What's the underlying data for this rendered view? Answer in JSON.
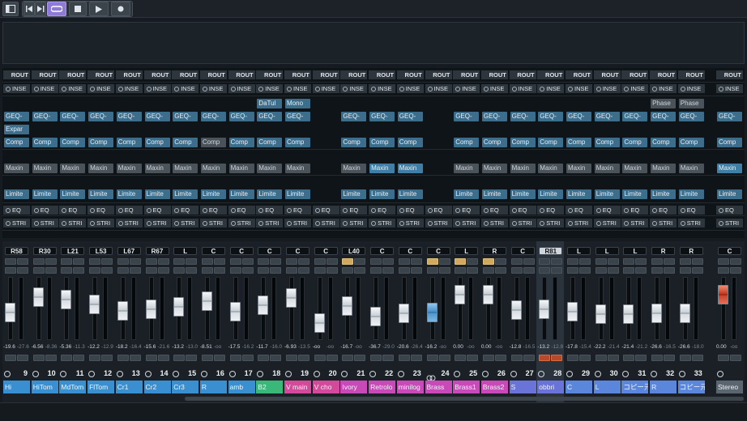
{
  "toolbar": {
    "buttons": [
      {
        "name": "window-layout-button",
        "icon": "layout-icon"
      },
      {
        "name": "go-to-start-button",
        "icon": "skip-back-icon"
      },
      {
        "name": "go-to-end-button",
        "icon": "skip-forward-icon"
      },
      {
        "name": "cycle-button",
        "icon": "cycle-icon",
        "active": true
      },
      {
        "name": "stop-button",
        "icon": "stop-icon"
      },
      {
        "name": "play-button",
        "icon": "play-icon"
      },
      {
        "name": "record-button",
        "icon": "record-icon"
      }
    ],
    "accent": "#8e7bd8"
  },
  "rack_labels": {
    "routing": "ROUT",
    "inserts": "INSE",
    "eq": "EQ",
    "strip": "STRI"
  },
  "channels": [
    {
      "pan": "R58",
      "vol": "-19.6",
      "peak": "-27.6",
      "num": "9",
      "name": "Hi",
      "color": "#3a8fd0",
      "fader": 0.42,
      "plugins": [
        "",
        "",
        "GEQ-",
        "Expar",
        "Comp",
        "Maxin",
        "Limite"
      ],
      "pstyle": [
        "",
        "",
        "b",
        "b",
        "b",
        "g",
        "b"
      ]
    },
    {
      "pan": "R30",
      "vol": "-6.56",
      "peak": "-8.36",
      "num": "10",
      "name": "HiTom",
      "color": "#3a8fd0",
      "fader": 0.78,
      "plugins": [
        "",
        "",
        "GEQ-",
        "",
        "Comp",
        "Maxin",
        "Limite"
      ],
      "pstyle": [
        "",
        "",
        "b",
        "",
        "b",
        "g",
        "b"
      ]
    },
    {
      "pan": "L21",
      "vol": "-5.36",
      "peak": "-11.3",
      "num": "11",
      "name": "MdTom",
      "color": "#3a8fd0",
      "fader": 0.72,
      "plugins": [
        "",
        "",
        "GEQ-",
        "",
        "Comp",
        "Maxin",
        "Limite"
      ],
      "pstyle": [
        "",
        "",
        "b",
        "",
        "b",
        "g",
        "b"
      ]
    },
    {
      "pan": "L53",
      "vol": "-12.2",
      "peak": "-12.9",
      "num": "12",
      "name": "FlTom",
      "color": "#3a8fd0",
      "fader": 0.62,
      "plugins": [
        "",
        "",
        "GEQ-",
        "",
        "Comp",
        "Maxin",
        "Limite"
      ],
      "pstyle": [
        "",
        "",
        "b",
        "",
        "b",
        "g",
        "b"
      ]
    },
    {
      "pan": "L67",
      "vol": "-18.2",
      "peak": "-16.4",
      "num": "13",
      "name": "Cr1",
      "color": "#3a8fd0",
      "fader": 0.46,
      "plugins": [
        "",
        "",
        "GEQ-",
        "",
        "Comp",
        "Maxin",
        "Limite"
      ],
      "pstyle": [
        "",
        "",
        "b",
        "",
        "b",
        "g",
        "b"
      ]
    },
    {
      "pan": "R67",
      "vol": "-15.6",
      "peak": "-21.6",
      "num": "14",
      "name": "Cr2",
      "color": "#3a8fd0",
      "fader": 0.5,
      "plugins": [
        "",
        "",
        "GEQ-",
        "",
        "Comp",
        "Maxin",
        "Limite"
      ],
      "pstyle": [
        "",
        "",
        "b",
        "",
        "b",
        "g",
        "b"
      ]
    },
    {
      "pan": "L",
      "vol": "-13.2",
      "peak": "-13.0",
      "num": "15",
      "name": "Cr3",
      "color": "#3a8fd0",
      "fader": 0.55,
      "plugins": [
        "",
        "",
        "GEQ-",
        "",
        "Comp",
        "Maxin",
        "Limite"
      ],
      "pstyle": [
        "",
        "",
        "b",
        "",
        "b",
        "g",
        "b"
      ]
    },
    {
      "pan": "C",
      "vol": "-8.51",
      "peak": "-oo",
      "num": "16",
      "name": "R",
      "color": "#3a8fd0",
      "fader": 0.68,
      "plugins": [
        "",
        "",
        "GEQ-",
        "",
        "Comp",
        "Maxin",
        "Limite"
      ],
      "pstyle": [
        "",
        "",
        "b",
        "",
        "g",
        "g",
        "b"
      ]
    },
    {
      "pan": "C",
      "vol": "-17.5",
      "peak": "-16.2",
      "num": "17",
      "name": "amb",
      "color": "#3a8fd0",
      "fader": 0.45,
      "plugins": [
        "",
        "",
        "GEQ-",
        "",
        "Comp",
        "Maxin",
        "Limite"
      ],
      "pstyle": [
        "",
        "",
        "b",
        "",
        "b",
        "g",
        "b"
      ]
    },
    {
      "pan": "C",
      "vol": "-11.7",
      "peak": "-16.0",
      "num": "18",
      "name": "B2",
      "color": "#3ab87a",
      "fader": 0.6,
      "plugins": [
        "",
        "DaTul",
        "GEQ-",
        "",
        "Comp",
        "Maxin",
        "Limite"
      ],
      "pstyle": [
        "",
        "b",
        "b",
        "",
        "b",
        "g",
        "b"
      ]
    },
    {
      "pan": "C",
      "vol": "-6.93",
      "peak": "-13.5",
      "num": "19",
      "name": "V main",
      "color": "#d44a9a",
      "fader": 0.76,
      "plugins": [
        "",
        "Mono",
        "GEQ-",
        "",
        "Comp",
        "Maxin",
        "Limite"
      ],
      "pstyle": [
        "",
        "b",
        "b",
        "",
        "b",
        "g",
        "b"
      ]
    },
    {
      "pan": "C",
      "vol": "-oo",
      "peak": "-oo",
      "num": "20",
      "name": "V cho",
      "color": "#d44a9a",
      "fader": 0.18,
      "plugins": [
        "",
        "",
        "",
        "",
        "",
        "",
        ""
      ],
      "pstyle": [
        "",
        "",
        "",
        "",
        "",
        "",
        ""
      ]
    },
    {
      "pan": "L40",
      "vol": "-16.7",
      "peak": "-oo",
      "num": "21",
      "name": "Ivory",
      "color": "#c84ab8",
      "fader": 0.58,
      "gold": true,
      "plugins": [
        "",
        "",
        "GEQ-",
        "",
        "Comp",
        "Maxin",
        "Limite"
      ],
      "pstyle": [
        "",
        "",
        "b",
        "",
        "b",
        "g",
        "b"
      ]
    },
    {
      "pan": "C",
      "vol": "-36.7",
      "peak": "-29.0",
      "num": "22",
      "name": "Retrolo",
      "color": "#c84ab8",
      "fader": 0.34,
      "plugins": [
        "",
        "",
        "GEQ-",
        "",
        "Comp",
        "Maxin",
        "Limite"
      ],
      "pstyle": [
        "",
        "",
        "b",
        "",
        "b",
        "bb",
        "b"
      ]
    },
    {
      "pan": "C",
      "vol": "-20.6",
      "peak": "-26.4",
      "num": "23",
      "name": "minilog",
      "color": "#c84ab8",
      "fader": 0.4,
      "plugins": [
        "",
        "",
        "GEQ-",
        "",
        "Comp",
        "Maxin",
        "Limite"
      ],
      "pstyle": [
        "",
        "",
        "b",
        "",
        "b",
        "bb",
        "b"
      ]
    },
    {
      "pan": "C",
      "vol": "-16.2",
      "peak": "-oo",
      "num": "24",
      "name": "Brass",
      "color": "#c84ab8",
      "fader": 0.42,
      "blue": true,
      "gold": true,
      "link": true,
      "plugins": [
        "",
        "",
        "",
        "",
        "",
        "",
        ""
      ],
      "pstyle": [
        "",
        "",
        "",
        "",
        "",
        "",
        ""
      ]
    },
    {
      "pan": "L",
      "vol": "0.00",
      "peak": "-oo",
      "num": "25",
      "name": "Brass1",
      "color": "#c84ab8",
      "fader": 0.84,
      "gold": true,
      "plugins": [
        "",
        "",
        "GEQ-",
        "",
        "Comp",
        "Maxin",
        "Limite"
      ],
      "pstyle": [
        "",
        "",
        "b",
        "",
        "b",
        "g",
        "b"
      ]
    },
    {
      "pan": "R",
      "vol": "0.00",
      "peak": "-oo",
      "num": "26",
      "name": "Brass2",
      "color": "#c84ab8",
      "fader": 0.84,
      "gold": true,
      "plugins": [
        "",
        "",
        "GEQ-",
        "",
        "Comp",
        "Maxin",
        "Limite"
      ],
      "pstyle": [
        "",
        "",
        "b",
        "",
        "b",
        "g",
        "b"
      ]
    },
    {
      "pan": "C",
      "vol": "-12.8",
      "peak": "-16.5",
      "num": "27",
      "name": "S",
      "color": "#6a74d8",
      "fader": 0.48,
      "plugins": [
        "",
        "",
        "GEQ-",
        "",
        "Comp",
        "Maxin",
        "Limite"
      ],
      "pstyle": [
        "",
        "",
        "b",
        "",
        "b",
        "g",
        "b"
      ]
    },
    {
      "pan": "R81",
      "vol": "-13.2",
      "peak": "-12.8",
      "num": "28",
      "name": "obbri",
      "color": "#6a74d8",
      "fader": 0.5,
      "selected": true,
      "red": true,
      "plugins": [
        "",
        "",
        "GEQ-",
        "",
        "Comp",
        "Maxin",
        "Limite"
      ],
      "pstyle": [
        "",
        "",
        "b",
        "",
        "b",
        "g",
        "b"
      ]
    },
    {
      "pan": "L",
      "vol": "-17.8",
      "peak": "-15.4",
      "num": "29",
      "name": "C",
      "color": "#5a86dc",
      "fader": 0.45,
      "plugins": [
        "",
        "",
        "GEQ-",
        "",
        "Comp",
        "Maxin",
        "Limite"
      ],
      "pstyle": [
        "",
        "",
        "b",
        "",
        "b",
        "g",
        "b"
      ]
    },
    {
      "pan": "L",
      "vol": "-22.2",
      "peak": "-21.4",
      "num": "30",
      "name": "L",
      "color": "#5a86dc",
      "fader": 0.38,
      "plugins": [
        "",
        "",
        "GEQ-",
        "",
        "Comp",
        "Maxin",
        "Limite"
      ],
      "pstyle": [
        "",
        "",
        "b",
        "",
        "b",
        "g",
        "b"
      ]
    },
    {
      "pan": "L",
      "vol": "-21.4",
      "peak": "-21.2",
      "num": "31",
      "name": "コピー元",
      "color": "#5a86dc",
      "fader": 0.38,
      "plugins": [
        "",
        "",
        "GEQ-",
        "",
        "Comp",
        "Maxin",
        "Limite"
      ],
      "pstyle": [
        "",
        "",
        "b",
        "",
        "b",
        "g",
        "b"
      ]
    },
    {
      "pan": "R",
      "vol": "-26.6",
      "peak": "-16.5",
      "num": "32",
      "name": "R",
      "color": "#5a86dc",
      "fader": 0.4,
      "plugins": [
        "",
        "Phase",
        "GEQ-",
        "",
        "Comp",
        "Maxin",
        "Limite"
      ],
      "pstyle": [
        "",
        "g",
        "b",
        "",
        "b",
        "g",
        "b"
      ]
    },
    {
      "pan": "R",
      "vol": "-26.6",
      "peak": "-18.0",
      "num": "33",
      "name": "コピー元",
      "color": "#5a86dc",
      "fader": 0.4,
      "plugins": [
        "",
        "Phase",
        "GEQ-",
        "",
        "Comp",
        "Maxin",
        "Limite"
      ],
      "pstyle": [
        "",
        "g",
        "b",
        "",
        "b",
        "g",
        "b"
      ]
    }
  ],
  "stereo": {
    "pan": "C",
    "vol": "0.00",
    "peak": "-oo",
    "name": "Stereo",
    "color": "#5a6570",
    "fader": 0.84,
    "plugins": [
      "",
      "",
      "GEQ-",
      "",
      "Comp",
      "Maxin",
      "Limite"
    ],
    "pstyle": [
      "",
      "",
      "b",
      "",
      "b",
      "bb",
      "b"
    ]
  }
}
